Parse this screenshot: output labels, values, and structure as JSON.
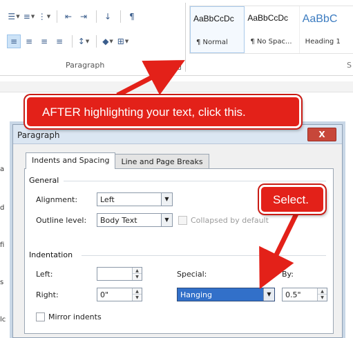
{
  "ribbon": {
    "group_label": "Paragraph",
    "styles": [
      {
        "sample": "AaBbCcDc",
        "name": "¶ Normal"
      },
      {
        "sample": "AaBbCcDc",
        "name": "¶ No Spac..."
      },
      {
        "sample": "AaBbC",
        "name": "Heading 1"
      }
    ],
    "styles_group_fragment": "S"
  },
  "dialog": {
    "title": "Paragraph",
    "close_label": "X",
    "tabs": [
      "Indents and Spacing",
      "Line and Page Breaks"
    ],
    "general": {
      "heading": "General",
      "alignment_label": "Alignment:",
      "alignment_value": "Left",
      "outline_label": "Outline level:",
      "outline_value": "Body Text",
      "collapsed_label": "Collapsed by default"
    },
    "indentation": {
      "heading": "Indentation",
      "left_label": "Left:",
      "left_value": "",
      "right_label": "Right:",
      "right_value": "0\"",
      "special_label": "Special:",
      "special_value": "Hanging",
      "by_label": "By:",
      "by_value": "0.5\"",
      "mirror_label": "Mirror indents"
    }
  },
  "callouts": {
    "main": "AFTER highlighting your text, click this.",
    "select": "Select."
  },
  "colors": {
    "callout_red": "#e32119",
    "highlight_blue": "#3270c9"
  }
}
